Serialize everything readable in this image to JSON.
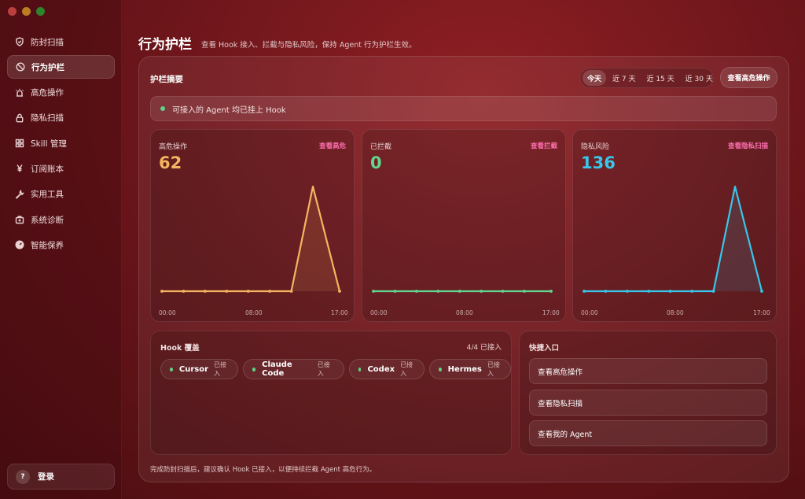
{
  "sidebar": {
    "items": [
      {
        "label": "防封扫描",
        "icon": "shield-icon"
      },
      {
        "label": "行为护栏",
        "icon": "ban-icon"
      },
      {
        "label": "高危操作",
        "icon": "alarm-icon"
      },
      {
        "label": "隐私扫描",
        "icon": "lock-icon"
      },
      {
        "label": "Skill 管理",
        "icon": "grid-icon"
      },
      {
        "label": "订阅账本",
        "icon": "yen-icon"
      },
      {
        "label": "实用工具",
        "icon": "wrench-icon"
      },
      {
        "label": "系统诊断",
        "icon": "toolbox-icon"
      },
      {
        "label": "智能保养",
        "icon": "gauge-icon"
      }
    ],
    "active_index": 1,
    "login_label": "登录",
    "login_icon_text": "?"
  },
  "header": {
    "title": "行为护栏",
    "subtitle": "查看 Hook 接入、拦截与隐私风险，保持 Agent 行为护栏生效。"
  },
  "summary": {
    "title": "护栏摘要",
    "ranges": [
      "今天",
      "近 7 天",
      "近 15 天",
      "近 30 天"
    ],
    "selected_range": 0,
    "view_high_risk_button": "查看高危操作",
    "banner_text": "可接入的 Agent 均已挂上 Hook"
  },
  "cards": [
    {
      "title": "高危操作",
      "link": "查看高危",
      "value": "62",
      "color": "#f5b560",
      "ticks": [
        "00:00",
        "08:00",
        "17:00"
      ]
    },
    {
      "title": "已拦截",
      "link": "查看拦截",
      "value": "0",
      "color": "#62d68f",
      "ticks": [
        "00:00",
        "08:00",
        "17:00"
      ]
    },
    {
      "title": "隐私风险",
      "link": "查看隐私扫描",
      "value": "136",
      "color": "#38c6ea",
      "ticks": [
        "00:00",
        "08:00",
        "17:00"
      ]
    }
  ],
  "chart_data": [
    {
      "type": "line",
      "title": "高危操作",
      "x": [
        0,
        1,
        2,
        3,
        4,
        5,
        6,
        7,
        8
      ],
      "values": [
        0,
        0,
        0,
        0,
        0,
        0,
        0,
        62,
        0
      ]
    },
    {
      "type": "line",
      "title": "已拦截",
      "x": [
        0,
        1,
        2,
        3,
        4,
        5,
        6,
        7,
        8
      ],
      "values": [
        0,
        0,
        0,
        0,
        0,
        0,
        0,
        0,
        0
      ]
    },
    {
      "type": "line",
      "title": "隐私风险",
      "x": [
        0,
        1,
        2,
        3,
        4,
        5,
        6,
        7,
        8
      ],
      "values": [
        0,
        0,
        0,
        0,
        0,
        0,
        0,
        136,
        0
      ]
    }
  ],
  "hook": {
    "title": "Hook 覆盖",
    "count": "4/4 已接入",
    "agents": [
      {
        "name": "Cursor",
        "status": "已接入"
      },
      {
        "name": "Claude Code",
        "status": "已接入"
      },
      {
        "name": "Codex",
        "status": "已接入"
      },
      {
        "name": "Hermes",
        "status": "已接入"
      }
    ]
  },
  "quick": {
    "title": "快捷入口",
    "buttons": [
      "查看高危操作",
      "查看隐私扫描",
      "查看我的 Agent"
    ]
  },
  "footer_note": "完成防封扫描后，建议确认 Hook 已接入，以便持续拦截 Agent 高危行为。"
}
